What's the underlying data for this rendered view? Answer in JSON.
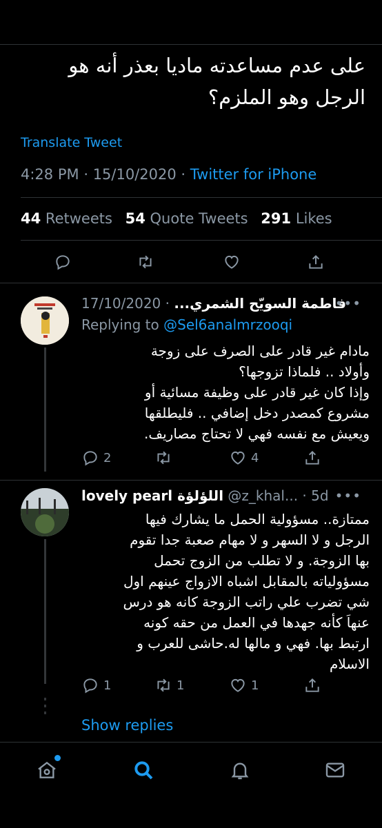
{
  "tweet": {
    "text_line1": "على عدم مساعدته ماديا بعذر أنه هو",
    "text_line2": "الرجل وهو الملزم؟",
    "translate": "Translate Tweet",
    "time": "4:28 PM",
    "date": "15/10/2020",
    "dot": "·",
    "source": "Twitter for iPhone",
    "retweets_count": "44",
    "retweets_label": "Retweets",
    "quotes_count": "54",
    "quotes_label": "Quote Tweets",
    "likes_count": "291",
    "likes_label": "Likes"
  },
  "replies": [
    {
      "name": "فاطمة السويّح الشمري...",
      "date": "17/10/2020",
      "dot": "·",
      "replying_prefix": "Replying to",
      "replying_to": "@Sel6analmrzooqi",
      "lines": [
        "مادام غير قادر على الصرف على زوجة",
        "وأولاد .. فلماذا تزوجها؟",
        "وإذا كان غير قادر على وظيفة مسائية أو",
        "مشروع كمصدر دخل إضافي .. فليطلقها",
        "ويعيش مع نفسه فهي لا تحتاج مصاريف."
      ],
      "reply_count": "2",
      "retweet_count": "",
      "like_count": "4",
      "more": "•••"
    },
    {
      "name": "lovely pearl اللؤلؤة",
      "handle": "@z_khal...",
      "age": "5d",
      "dot": "·",
      "lines": [
        "ممتازة.. مسؤولية الحمل ما يشارك فيها",
        "الرجل و لا السهر و لا مهام صعبة جدا تقوم",
        "بها الزوجة. و لا تطلب من الزوج تحمل",
        "مسؤولياته بالمقابل اشباه الازواج عينهم اول",
        "شي تضرب علي راتب الزوجة كانه هو درس",
        "عنهاَ كأنه جهدها في العمل من حقه كونه",
        "ارتبط بها. فهي و مالها له.حاشى للعرب و",
        "الاسلام"
      ],
      "reply_count": "1",
      "retweet_count": "1",
      "like_count": "1",
      "more": "•••"
    }
  ],
  "show_replies": "Show replies",
  "colors": {
    "accent": "#1d9bf0",
    "muted": "#8b98a5",
    "background": "#000000"
  },
  "icons": [
    "reply-icon",
    "retweet-icon",
    "like-icon",
    "share-icon",
    "home-icon",
    "search-icon",
    "notifications-icon",
    "messages-icon"
  ]
}
